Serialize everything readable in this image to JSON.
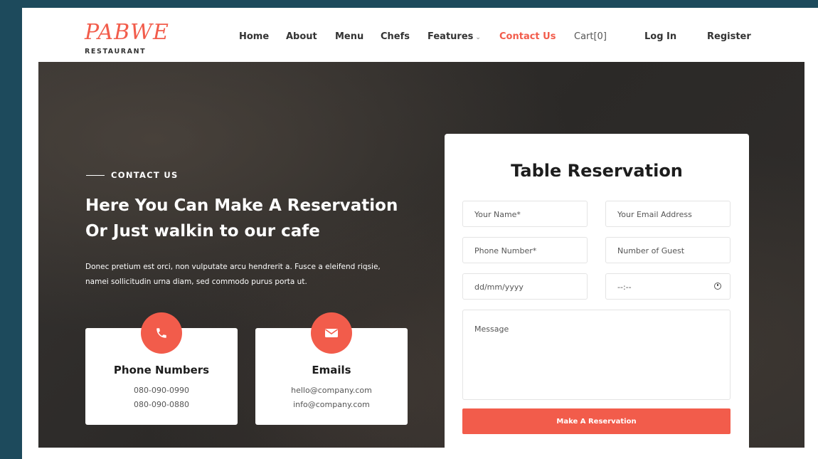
{
  "header": {
    "logo_script": "PABWE",
    "logo_sub": "RESTAURANT",
    "nav": [
      {
        "label": "Home"
      },
      {
        "label": "About"
      },
      {
        "label": "Menu"
      },
      {
        "label": "Chefs"
      },
      {
        "label": "Features"
      },
      {
        "label": "Contact Us"
      },
      {
        "label": "Cart[0]"
      },
      {
        "label": "Log In"
      },
      {
        "label": "Register"
      }
    ]
  },
  "hero": {
    "eyebrow": "CONTACT US",
    "headline": "Here You Can Make A Reservation Or Just walkin to our cafe",
    "paragraph": "Donec pretium est orci, non vulputate arcu hendrerit a. Fusce a eleifend riqsie, namei sollicitudin urna diam, sed commodo purus porta ut.",
    "cards": [
      {
        "title": "Phone Numbers",
        "line1": "080-090-0990",
        "line2": "080-090-0880",
        "icon": "phone-icon"
      },
      {
        "title": "Emails",
        "line1": "hello@company.com",
        "line2": "info@company.com",
        "icon": "envelope-icon"
      }
    ]
  },
  "form": {
    "title": "Table Reservation",
    "name_placeholder": "Your Name*",
    "email_placeholder": "Your Email Address",
    "phone_placeholder": "Phone Number*",
    "guests_placeholder": "Number of Guest",
    "date_placeholder": "dd/mm/yyyy",
    "time_placeholder": "--:--",
    "message_placeholder": "Message",
    "submit_label": "Make A Reservation"
  },
  "colors": {
    "accent": "#f25c4b",
    "page_bg": "#1d4a5c"
  }
}
